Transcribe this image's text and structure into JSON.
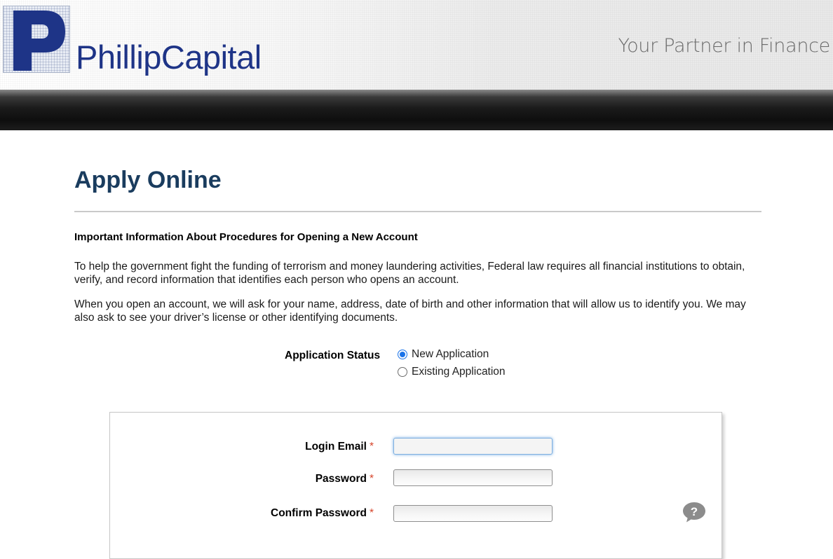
{
  "header": {
    "logo_letter": "P",
    "logo_text": "PhillipCapital",
    "tagline": "Your Partner in Finance"
  },
  "main": {
    "title": "Apply Online",
    "info_heading": "Important Information About Procedures for Opening a New Account",
    "paragraph1": "To help the government fight the funding of terrorism and money laundering activities, Federal law requires all financial institutions to obtain, verify, and record information that identifies each person who opens an account.",
    "paragraph2": "When you open an account, we will ask for your name, address, date of birth and other information that will allow us to identify you. We may also ask to see your driver’s license or other identifying documents."
  },
  "application_status": {
    "label": "Application Status",
    "options": [
      {
        "label": "New Application",
        "selected": true
      },
      {
        "label": "Existing Application",
        "selected": false
      }
    ]
  },
  "form": {
    "fields": [
      {
        "label": "Login Email",
        "required_mark": "*",
        "value": "",
        "focused": true
      },
      {
        "label": "Password",
        "required_mark": "*",
        "value": ""
      },
      {
        "label": "Confirm Password",
        "required_mark": "*",
        "value": ""
      }
    ],
    "help_icon": "question-speech-bubble-icon"
  },
  "colors": {
    "brand_blue": "#1e3487",
    "title_color": "#1a3c5e",
    "required_color": "#d6452b",
    "radio_selected": "#1a73e8"
  }
}
